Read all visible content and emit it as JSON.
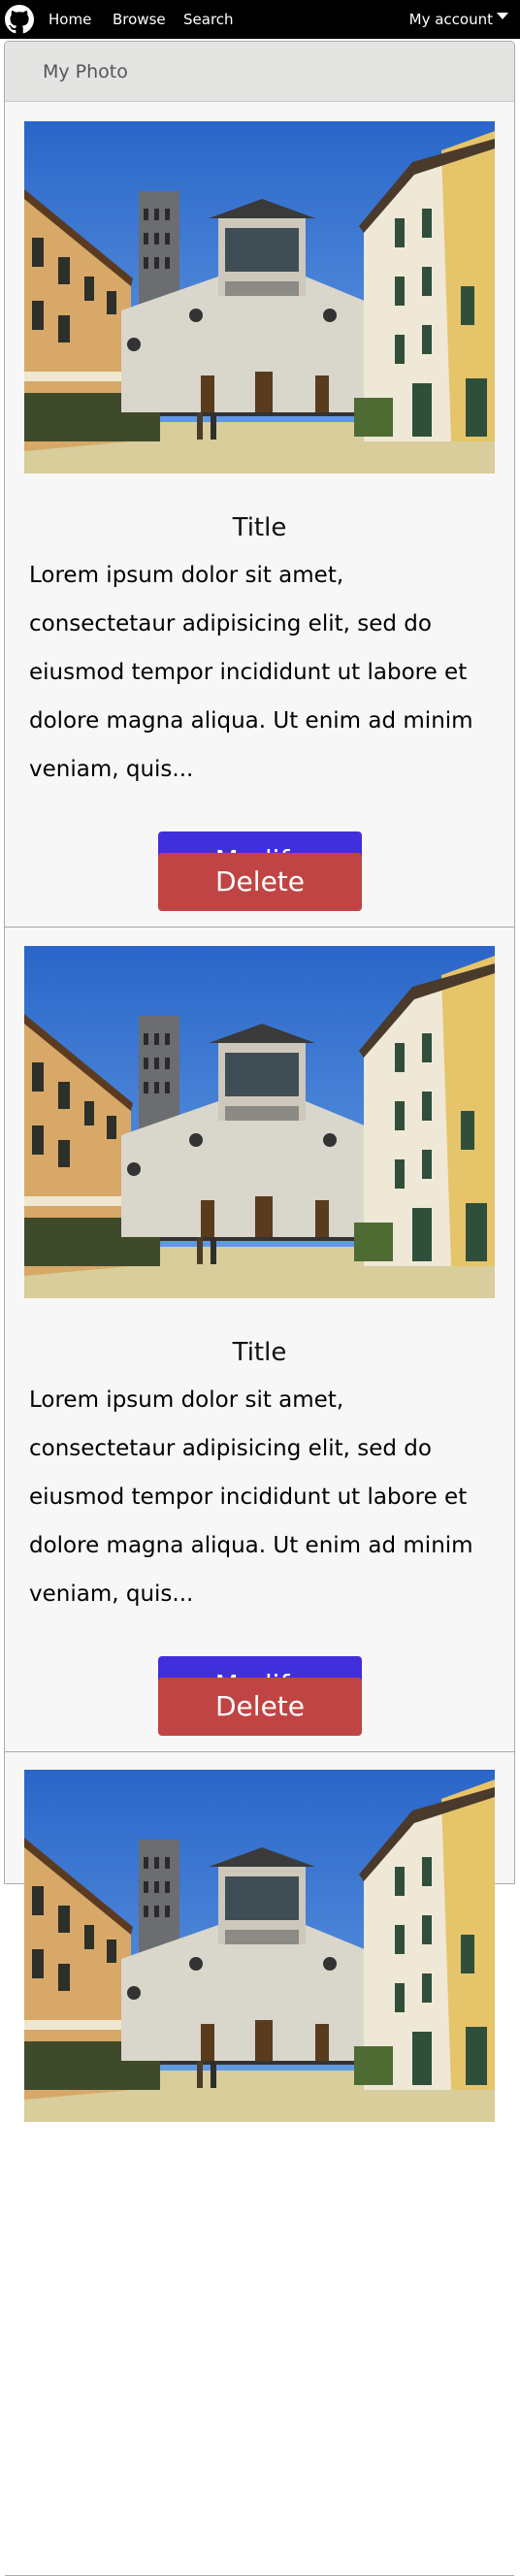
{
  "navbar": {
    "logo_icon": "github-icon",
    "links": [
      {
        "label": "Home"
      },
      {
        "label": "Browse"
      },
      {
        "label": "Search"
      }
    ],
    "account_label": "My account",
    "account_icon": "caret-down-icon"
  },
  "panel": {
    "title": "My Photo"
  },
  "cards": [
    {
      "title": "Title",
      "description": "Lorem ipsum dolor sit amet, consectetaur adipisicing elit, sed do eiusmod tempor incididunt ut labore et dolore magna aliqua. Ut enim ad minim veniam, quis...",
      "modify_label": "Modify",
      "delete_label": "Delete"
    },
    {
      "title": "Title",
      "description": "Lorem ipsum dolor sit amet, consectetaur adipisicing elit, sed do eiusmod tempor incididunt ut labore et dolore magna aliqua. Ut enim ad minim veniam, quis...",
      "modify_label": "Modify",
      "delete_label": "Delete"
    }
  ],
  "colors": {
    "navbar_bg": "#000000",
    "modify_button": "#412fdc",
    "delete_button": "#c04443"
  }
}
